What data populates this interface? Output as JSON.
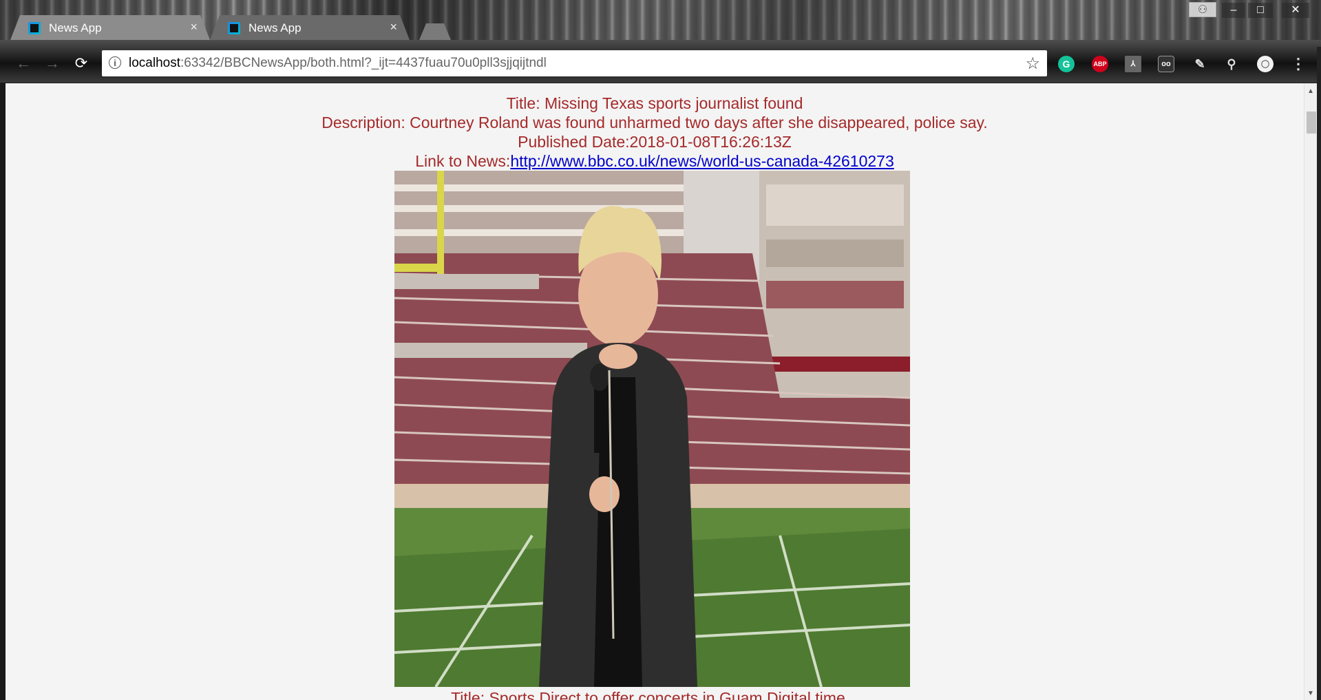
{
  "browser": {
    "tabs": [
      {
        "title": "News App",
        "favicon": "webstorm-icon",
        "active": false
      },
      {
        "title": "News App",
        "favicon": "webstorm-icon",
        "active": true
      }
    ],
    "close_glyph": "×",
    "window_controls": {
      "minimize": "–",
      "maximize": "□",
      "close": "✕",
      "profile": "⚇"
    },
    "nav": {
      "back": "←",
      "forward": "→",
      "reload": "⟳"
    },
    "url_host": "localhost",
    "url_rest": ":63342/BBCNewsApp/both.html?_ijt=4437fuau70u0pll3sjjqijtndl",
    "extensions": [
      {
        "name": "grammarly-icon",
        "glyph": "G",
        "color": "#15c39a"
      },
      {
        "name": "adblock-plus-icon",
        "glyph": "ABP",
        "color": "#d0021b"
      },
      {
        "name": "pdf-icon",
        "glyph": "⅄",
        "color": "#666666"
      },
      {
        "name": "reader-icon",
        "glyph": "oo",
        "color": "#333333"
      },
      {
        "name": "pen-icon",
        "glyph": "✎"
      },
      {
        "name": "search-icon",
        "glyph": "⚲"
      },
      {
        "name": "account-icon",
        "glyph": "◯"
      },
      {
        "name": "menu-icon",
        "glyph": "⋮"
      }
    ]
  },
  "article": {
    "title_line": "Title: Missing Texas sports journalist found",
    "description_line": "Description: Courtney Roland was found unharmed two days after she disappeared, police say.",
    "date_line": "Published Date:2018-01-08T16:26:13Z",
    "link_label": "Link to News:",
    "link_url": "http://www.bbc.co.uk/news/world-us-canada-42610273",
    "image_subject": "reporter-in-stadium-photo"
  },
  "next_article": {
    "title_line": "Title: Sports Direct to offer concerts in Guam Digital time..."
  },
  "colors": {
    "article_text": "#a52a2a",
    "link": "#0000cc",
    "page_bg": "#f4f4f4"
  },
  "scrollbar": {
    "up": "▲",
    "down": "▼"
  }
}
